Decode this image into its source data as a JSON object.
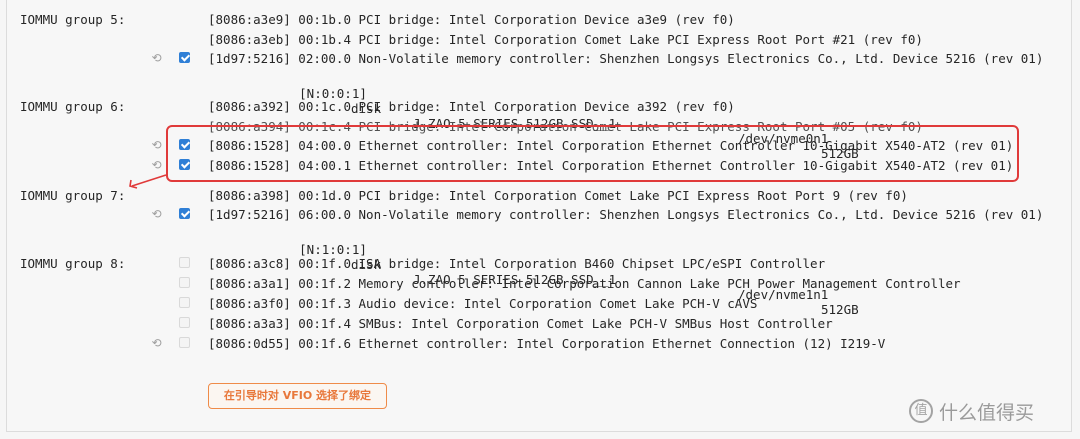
{
  "groups": [
    {
      "label": "IOMMU group 5:"
    },
    {
      "label": "IOMMU group 6:"
    },
    {
      "label": "IOMMU group 7:"
    },
    {
      "label": "IOMMU group 8:"
    }
  ],
  "rows": {
    "r5a": "[8086:a3e9] 00:1b.0 PCI bridge: Intel Corporation Device a3e9 (rev f0)",
    "r5b": "[8086:a3eb] 00:1b.4 PCI bridge: Intel Corporation Comet Lake PCI Express Root Port #21 (rev f0)",
    "r5c": "[1d97:5216] 02:00.0 Non-Volatile memory controller: Shenzhen Longsys Electronics Co., Ltd. Device 5216 (rev 01)",
    "r5c_sub": [
      "[N:0:0:1]",
      "disk",
      "J.ZAO 5 SERIES 512GB SSD__1",
      "/dev/nvme0n1",
      "512GB"
    ],
    "r6a": "[8086:a392] 00:1c.0 PCI bridge: Intel Corporation Device a392 (rev f0)",
    "r6b": "[8086:a394] 00:1c.4 PCI bridge: Intel Corporation Comet Lake PCI Express Root Port #05 (rev f0)",
    "r6c": "[8086:1528] 04:00.0 Ethernet controller: Intel Corporation Ethernet Controller 10-Gigabit X540-AT2 (rev 01)",
    "r6d": "[8086:1528] 04:00.1 Ethernet controller: Intel Corporation Ethernet Controller 10-Gigabit X540-AT2 (rev 01)",
    "r7a": "[8086:a398] 00:1d.0 PCI bridge: Intel Corporation Comet Lake PCI Express Root Port 9 (rev f0)",
    "r7b": "[1d97:5216] 06:00.0 Non-Volatile memory controller: Shenzhen Longsys Electronics Co., Ltd. Device 5216 (rev 01)",
    "r7b_sub": [
      "[N:1:0:1]",
      "disk",
      "J.ZAO 5 SERIES 512GB SSD__1",
      "/dev/nvme1n1",
      "512GB"
    ],
    "r8a": "[8086:a3c8] 00:1f.0 ISA bridge: Intel Corporation B460 Chipset LPC/eSPI Controller",
    "r8b": "[8086:a3a1] 00:1f.2 Memory controller: Intel Corporation Cannon Lake PCH Power Management Controller",
    "r8c": "[8086:a3f0] 00:1f.3 Audio device: Intel Corporation Comet Lake PCH-V cAVS",
    "r8d": "[8086:a3a3] 00:1f.4 SMBus: Intel Corporation Comet Lake PCH-V SMBus Host Controller",
    "r8e": "[8086:0d55] 00:1f.6 Ethernet controller: Intel Corporation Ethernet Connection (12) I219-V"
  },
  "checkboxes": {
    "r5c": true,
    "r6c": true,
    "r6d": true,
    "r7b": true,
    "r8a": false,
    "r8b": false,
    "r8c": false,
    "r8d": false,
    "r8e": false
  },
  "icons": {
    "refresh": "refresh-icon",
    "logo": "zhidemai-logo-icon"
  },
  "colors": {
    "checked": "#2f7fd6",
    "highlight": "#e03a3a",
    "button": "#ef8b48"
  },
  "button": {
    "vfio_label": "在引导时对 VFIO 选择了绑定"
  },
  "watermark": {
    "logo_char": "值",
    "text": "什么值得买"
  }
}
